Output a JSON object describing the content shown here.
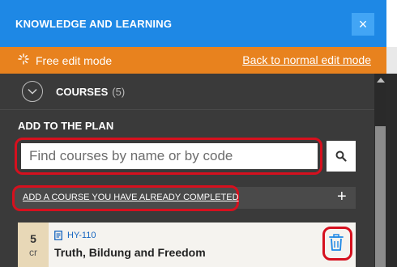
{
  "header": {
    "title": "KNOWLEDGE AND LEARNING",
    "close_label": "×"
  },
  "mode_bar": {
    "mode_text": "Free edit mode",
    "back_link": "Back to normal edit mode"
  },
  "courses": {
    "label": "COURSES",
    "count": "(5)"
  },
  "add_section": {
    "label": "ADD TO THE PLAN",
    "search_placeholder": "Find courses by name or by code",
    "completed_link": "ADD A COURSE YOU HAVE ALREADY COMPLETED",
    "plus_label": "+"
  },
  "course_card": {
    "credits": "5",
    "credits_unit": "cr",
    "code": "HY-110",
    "name": "Truth, Bildung and Freedom"
  },
  "icons": {
    "close": "close-icon",
    "mode": "sparkle-icon",
    "chevron": "chevron-down-icon",
    "search": "search-icon",
    "plus": "plus-icon",
    "document": "document-icon",
    "trash": "trash-icon"
  },
  "colors": {
    "header_bg": "#1e88e5",
    "mode_bar_bg": "#e8821e",
    "panel_bg": "#3a3a3a",
    "highlight": "#d6101e",
    "credits_bg": "#e8d8b7",
    "code_color": "#1565c0"
  }
}
